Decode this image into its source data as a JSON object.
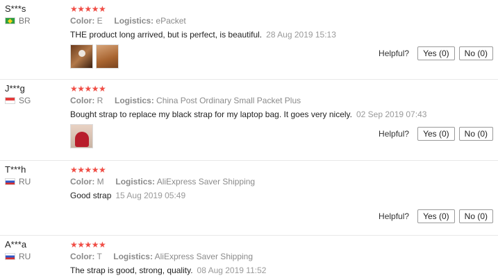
{
  "reviews": [
    {
      "user": "S***s",
      "country": "BR",
      "flag": "br",
      "stars": "★★★★★",
      "color_label": "Color:",
      "color_value": "E",
      "logistics_label": "Logistics:",
      "logistics_value": "ePacket",
      "text": "THE product long arrived, but is perfect, is beautiful.",
      "date": "28 Aug 2019 15:13",
      "helpful_label": "Helpful?",
      "yes_label": "Yes (0)",
      "no_label": "No (0)"
    },
    {
      "user": "J***g",
      "country": "SG",
      "flag": "sg",
      "stars": "★★★★★",
      "color_label": "Color:",
      "color_value": "R",
      "logistics_label": "Logistics:",
      "logistics_value": "China Post Ordinary Small Packet Plus",
      "text": "Bought strap to replace my black strap for my laptop bag. It goes very nicely.",
      "date": "02 Sep 2019 07:43",
      "helpful_label": "Helpful?",
      "yes_label": "Yes (0)",
      "no_label": "No (0)"
    },
    {
      "user": "T***h",
      "country": "RU",
      "flag": "ru",
      "stars": "★★★★★",
      "color_label": "Color:",
      "color_value": "M",
      "logistics_label": "Logistics:",
      "logistics_value": "AliExpress Saver Shipping",
      "text": "Good strap",
      "date": "15 Aug 2019 05:49",
      "helpful_label": "Helpful?",
      "yes_label": "Yes (0)",
      "no_label": "No (0)"
    },
    {
      "user": "A***a",
      "country": "RU",
      "flag": "ru",
      "stars": "★★★★★",
      "color_label": "Color:",
      "color_value": "T",
      "logistics_label": "Logistics:",
      "logistics_value": "AliExpress Saver Shipping",
      "text": "The strap is good, strong, quality.",
      "date": "08 Aug 2019 11:52"
    }
  ]
}
